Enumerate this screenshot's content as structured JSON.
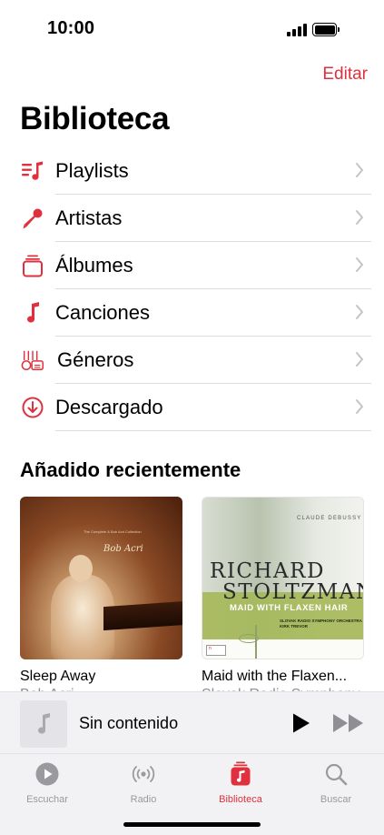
{
  "status": {
    "time": "10:00"
  },
  "header": {
    "edit_label": "Editar",
    "title": "Biblioteca"
  },
  "library": {
    "items": [
      {
        "label": "Playlists",
        "icon": "playlist-icon"
      },
      {
        "label": "Artistas",
        "icon": "microphone-icon"
      },
      {
        "label": "Álbumes",
        "icon": "album-stack-icon"
      },
      {
        "label": "Canciones",
        "icon": "music-note-icon"
      },
      {
        "label": "Géneros",
        "icon": "instruments-icon"
      },
      {
        "label": "Descargado",
        "icon": "download-circle-icon"
      }
    ]
  },
  "recent": {
    "title": "Añadido recientemente",
    "albums": [
      {
        "title": "Sleep Away",
        "artist": "Bob Acri",
        "cover_text": "Bob Acri",
        "cover_fine": "The Complete & Bob Acri Collection"
      },
      {
        "title": "Maid with the Flaxen...",
        "artist": "Slovak Radio Symphony",
        "cover_top": "CLAUDE DEBUSSY",
        "cover_line1": "RICHARD",
        "cover_line2": "STOLTZMAN",
        "cover_subtitle": "MAID WITH FLAXEN HAIR",
        "cover_orch": "SLOVAK RADIO SYMPHONY ORCHESTRA",
        "cover_conductor": "KIRK TREVOR"
      }
    ]
  },
  "player": {
    "title": "Sin contenido"
  },
  "tabs": [
    {
      "label": "Escuchar",
      "icon": "play-circle-icon",
      "active": false
    },
    {
      "label": "Radio",
      "icon": "radio-waves-icon",
      "active": false
    },
    {
      "label": "Biblioteca",
      "icon": "library-music-icon",
      "active": true
    },
    {
      "label": "Buscar",
      "icon": "search-icon",
      "active": false
    }
  ],
  "colors": {
    "accent": "#e0303e",
    "secondary_text": "#8e8e93",
    "bar_bg": "#f2f2f4"
  }
}
